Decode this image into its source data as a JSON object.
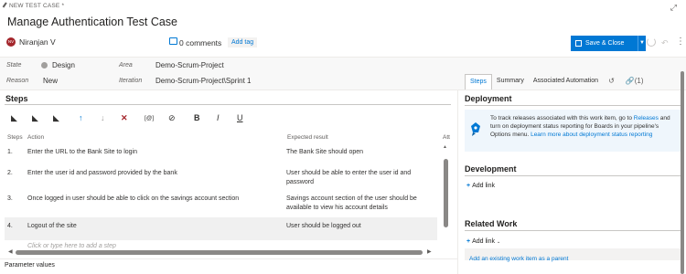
{
  "header": {
    "type_label": "NEW TEST CASE *",
    "title": "Manage Authentication Test Case",
    "assignee_initials": "NV",
    "assignee": "Niranjan V",
    "comments": "0 comments",
    "add_tag": "Add tag",
    "save_label": "Save & Close"
  },
  "fields": {
    "state_label": "State",
    "state_value": "Design",
    "reason_label": "Reason",
    "reason_value": "New",
    "area_label": "Area",
    "area_value": "Demo-Scrum-Project",
    "iteration_label": "Iteration",
    "iteration_value": "Demo-Scrum-Project\\Sprint 1"
  },
  "tabs": {
    "steps": "Steps",
    "summary": "Summary",
    "automation": "Associated Automation",
    "links_count": "(1)"
  },
  "steps": {
    "heading": "Steps",
    "col_steps": "Steps",
    "col_action": "Action",
    "col_expected": "Expected result",
    "col_att": "Att",
    "rows": [
      {
        "num": "1.",
        "action": "Enter the URL to the Bank Site to login",
        "expected": "The Bank Site should open"
      },
      {
        "num": "2.",
        "action": "Enter the user id and password provided by the bank",
        "expected": "User should be able to enter the user id and password"
      },
      {
        "num": "3.",
        "action": "Once logged in user should be able to click on the savings account section",
        "expected": "Savings account section of the user should be available to view his account details"
      },
      {
        "num": "4.",
        "action": "Logout of the site",
        "expected": "User should be logged out"
      }
    ],
    "placeholder": "Click or type here to add a step",
    "param_heading": "Parameter values"
  },
  "deployment": {
    "heading": "Deployment",
    "text_1": "To track releases associated with this work item, go to ",
    "link_1": "Releases",
    "text_2": " and turn on deployment status reporting for Boards in your pipeline's Options menu. ",
    "link_2": "Learn more about deployment status reporting"
  },
  "development": {
    "heading": "Development",
    "add_link": "Add link"
  },
  "related": {
    "heading": "Related Work",
    "add_link": "Add link",
    "existing": "Add an existing work item as a parent"
  },
  "colors": {
    "accent": "#0078d4",
    "avatar": "#a4262c",
    "highlight_row": "#f0f0f0"
  }
}
